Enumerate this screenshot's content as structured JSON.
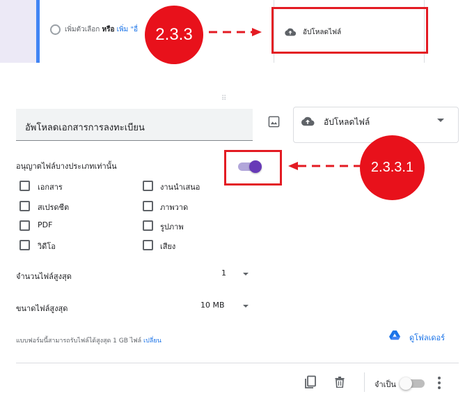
{
  "top_strip": {
    "add_option_text": "เพิ่มตัวเลือก",
    "or_text": "หรือ",
    "add_other_text": "เพิ่ม \"อื่",
    "dropdown_label": "อัปโหลดไฟล์"
  },
  "annotations": {
    "step_main": "2.3.3",
    "step_sub": "2.3.3.1",
    "highlight_color": "#e31b23"
  },
  "question": {
    "title": "อัพโหลดเอกสารการลงทะเบียน",
    "type_label": "อัปโหลดไฟล์"
  },
  "restrict": {
    "label": "อนุญาตไฟล์บางประเภทเท่านั้น",
    "enabled": true
  },
  "file_types": [
    {
      "label": "เอกสาร",
      "checked": false
    },
    {
      "label": "งานนำเสนอ",
      "checked": false
    },
    {
      "label": "สเปรดชีต",
      "checked": false
    },
    {
      "label": "ภาพวาด",
      "checked": false
    },
    {
      "label": "PDF",
      "checked": false
    },
    {
      "label": "รูปภาพ",
      "checked": false
    },
    {
      "label": "วิดีโอ",
      "checked": false
    },
    {
      "label": "เสียง",
      "checked": false
    }
  ],
  "max_files": {
    "label": "จำนวนไฟล์สูงสุด",
    "value": "1"
  },
  "max_size": {
    "label": "ขนาดไฟล์สูงสุด",
    "value": "10 MB"
  },
  "info": {
    "text": "แบบฟอร์มนี้สามารถรับไฟล์ได้สูงสุด 1 GB ไฟล์",
    "change_link": "เปลี่ยน"
  },
  "folder_link": "ดูโฟลเดอร์",
  "footer": {
    "required_label": "จำเป็น",
    "required_on": false
  },
  "colors": {
    "accent_purple": "#673ab7",
    "link_blue": "#1a73e8",
    "card_stripe": "#4285f4"
  },
  "icons": [
    "cloud-upload-icon",
    "image-icon",
    "drive-icon",
    "copy-icon",
    "trash-icon",
    "more-vert-icon",
    "drag-handle-icon"
  ]
}
